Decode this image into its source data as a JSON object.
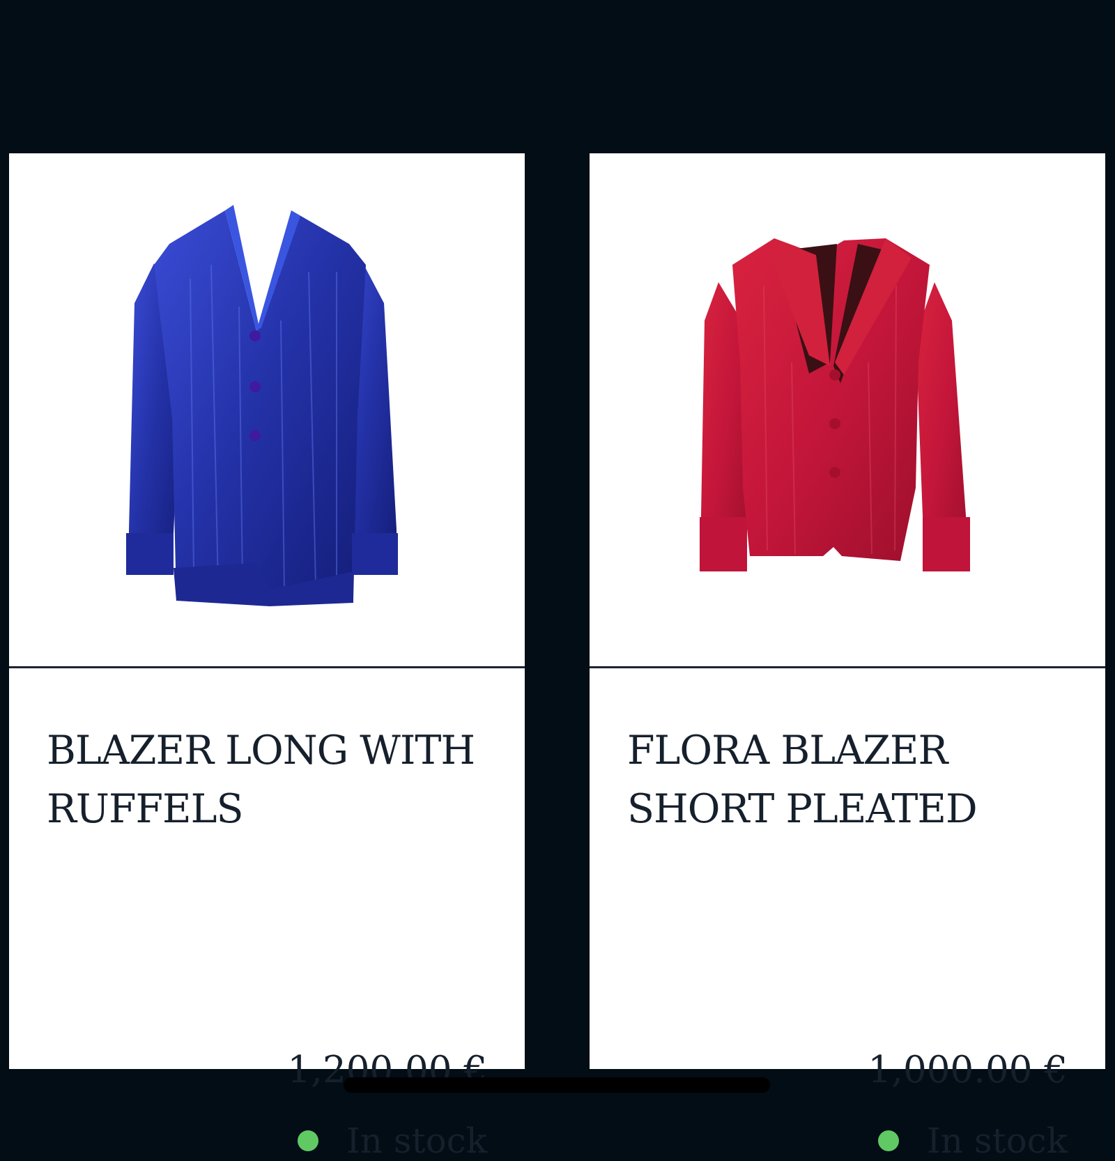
{
  "colors": {
    "background": "#020d16",
    "card": "#ffffff",
    "text": "#16202c",
    "stock_indicator": "#60c964",
    "blue_blazer": "#2331a6",
    "red_blazer": "#c4163a"
  },
  "products": [
    {
      "title_line1": "BLAZER LONG WITH",
      "title_line2": "RUFFELS",
      "price": "1,200.00 €",
      "stock": "In stock",
      "image": "blue-blazer-photo"
    },
    {
      "title_line1": "FLORA BLAZER",
      "title_line2": "SHORT PLEATED",
      "price": "1,000.00 €",
      "stock": "In stock",
      "image": "red-blazer-photo"
    }
  ]
}
